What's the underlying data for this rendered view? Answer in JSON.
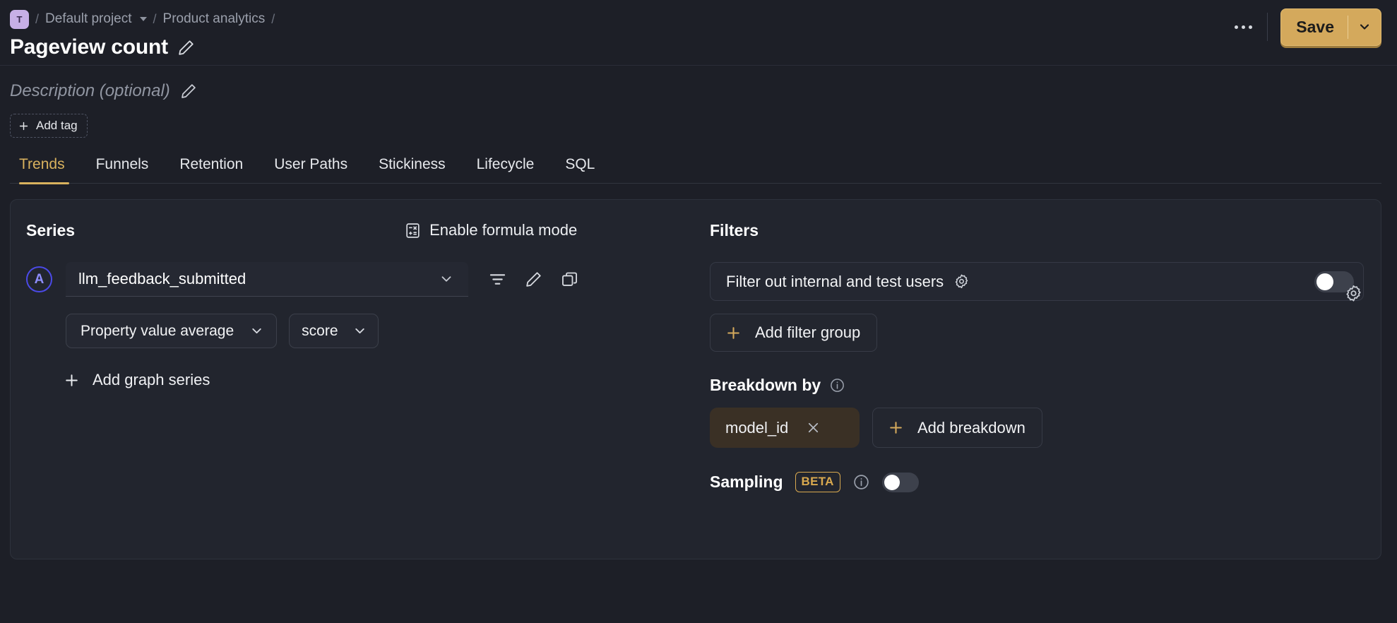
{
  "breadcrumb": {
    "project_initial": "T",
    "project": "Default project",
    "section": "Product analytics",
    "sep": "/"
  },
  "header": {
    "title": "Pageview count",
    "edit_icon": "pencil-icon",
    "more_icon": "ellipsis-icon",
    "save_label": "Save",
    "save_caret_icon": "chevron-down-icon",
    "accent": "#D4A95C"
  },
  "meta": {
    "description_placeholder": "Description (optional)",
    "description_edit_icon": "pencil-icon",
    "add_tag_label": "Add tag",
    "add_tag_icon": "plus-icon"
  },
  "tabs": [
    {
      "label": "Trends",
      "active": true
    },
    {
      "label": "Funnels",
      "active": false
    },
    {
      "label": "Retention",
      "active": false
    },
    {
      "label": "User Paths",
      "active": false
    },
    {
      "label": "Stickiness",
      "active": false
    },
    {
      "label": "Lifecycle",
      "active": false
    },
    {
      "label": "SQL",
      "active": false
    }
  ],
  "series": {
    "title": "Series",
    "formula_label": "Enable formula mode",
    "formula_icon": "calculator-icon",
    "entry": {
      "badge": "A",
      "event": "llm_feedback_submitted",
      "dropdown_icon": "chevron-down-icon",
      "filter_icon": "filter-icon",
      "edit_icon": "pencil-icon",
      "duplicate_icon": "copy-icon"
    },
    "math_pill": "Property value average",
    "math_pill_icon": "chevron-down-icon",
    "property_pill": "score",
    "property_pill_icon": "chevron-down-icon",
    "add_series_label": "Add graph series",
    "add_series_icon": "plus-icon"
  },
  "filters": {
    "title": "Filters",
    "internal_users_label": "Filter out internal and test users",
    "internal_users_gear_icon": "gear-icon",
    "internal_users_toggle": "off",
    "add_filter_group_label": "Add filter group",
    "add_filter_group_icon": "plus-icon"
  },
  "breakdown": {
    "title": "Breakdown by",
    "info_icon": "info-icon",
    "settings_icon": "gear-icon",
    "chip_label": "model_id",
    "chip_remove_icon": "close-icon",
    "add_label": "Add breakdown",
    "add_icon": "plus-icon"
  },
  "sampling": {
    "label": "Sampling",
    "badge": "BETA",
    "info_icon": "info-icon",
    "toggle": "off"
  }
}
